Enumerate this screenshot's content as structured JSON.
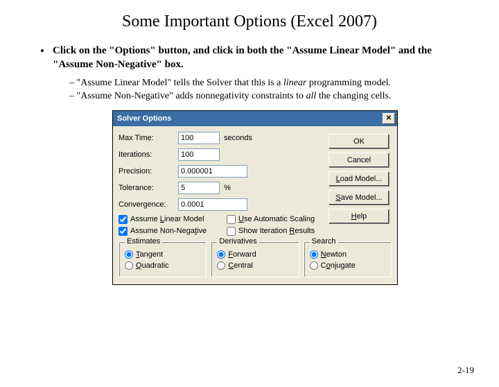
{
  "title": "Some Important Options (Excel 2007)",
  "bullet_main_a": "Click on the \"Options\" button, and click in both the \"Assume Linear Model\" and the \"Assume Non-Negative\" box.",
  "sub1_a": "\"Assume Linear Model\" tells the Solver that this is a ",
  "sub1_em": "linear",
  "sub1_b": " programming model.",
  "sub2_a": "\"Assume Non-Negative\" adds nonnegativity constraints to ",
  "sub2_em": "all",
  "sub2_b": " the changing cells.",
  "page": "2-19",
  "dlg": {
    "title": "Solver Options",
    "labels": {
      "max_time": "Max Time:",
      "iterations": "Iterations:",
      "precision": "Precision:",
      "tolerance": "Tolerance:",
      "convergence": "Convergence:"
    },
    "values": {
      "max_time": "100",
      "iterations": "100",
      "precision": "0.000001",
      "tolerance": "5",
      "convergence": "0.0001"
    },
    "suffix": {
      "seconds": "seconds",
      "pct": "%"
    },
    "buttons": {
      "ok": "OK",
      "cancel": "Cancel",
      "load": "Load Model...",
      "save": "Save Model...",
      "help": "Help"
    },
    "checkboxes": {
      "linear_pre": "Assume ",
      "linear_u": "L",
      "linear_post": "inear Model",
      "autoscale_u": "U",
      "autoscale_post": "se Automatic Scaling",
      "nonneg_pre": "Assume Non-Nega",
      "nonneg_u": "t",
      "nonneg_post": "ive",
      "showiter_pre": "Show Iteration ",
      "showiter_u": "R",
      "showiter_post": "esults"
    },
    "groups": {
      "estimates": "Estimates",
      "tangent_u": "T",
      "tangent_post": "angent",
      "quadratic_u": "Q",
      "quadratic_post": "uadratic",
      "derivatives": "Derivatives",
      "forward_u": "F",
      "forward_post": "orward",
      "central_u": "C",
      "central_post": "entral",
      "search": "Search",
      "newton_u": "N",
      "newton_post": "ewton",
      "conjugate_pre": "C",
      "conjugate_u": "o",
      "conjugate_post": "njugate"
    }
  }
}
